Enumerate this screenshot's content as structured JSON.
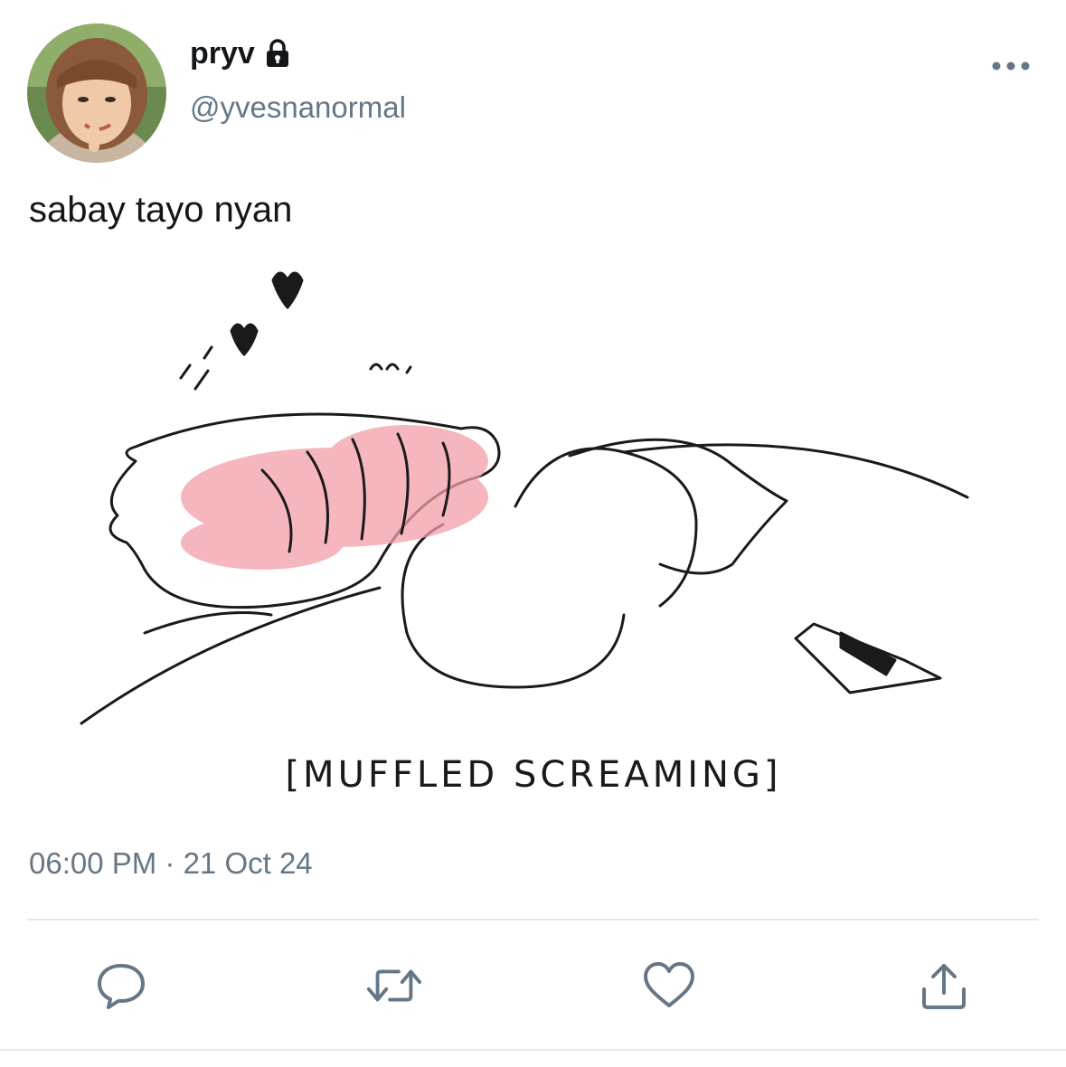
{
  "tweet": {
    "display_name": "pryv",
    "handle": "@yvesnanormal",
    "protected_icon": "lock-icon",
    "text": "sabay tayo nyan",
    "media_caption": "[MUFFLED SCREAMING]",
    "timestamp": "06:00 PM · 21 Oct 24"
  },
  "actions": [
    {
      "name": "reply",
      "icon": "comment-icon"
    },
    {
      "name": "retweet",
      "icon": "retweet-icon"
    },
    {
      "name": "like",
      "icon": "heart-icon"
    },
    {
      "name": "share",
      "icon": "share-icon"
    }
  ],
  "colors": {
    "text_primary": "#14171a",
    "text_secondary": "#657786",
    "icon": "#657786",
    "divider": "#e1e8ed",
    "blush": "#f2a0a8"
  }
}
